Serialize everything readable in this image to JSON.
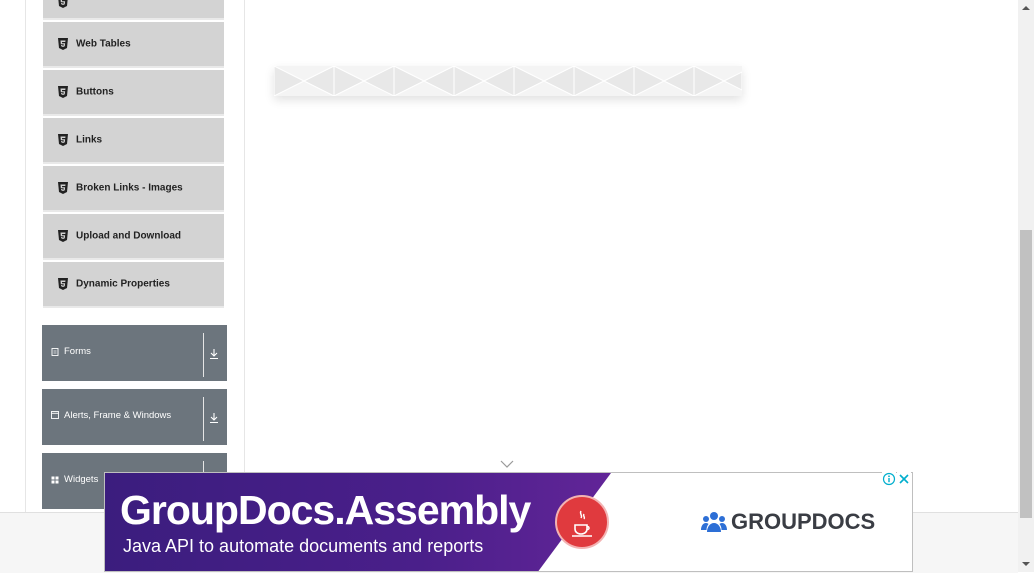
{
  "sidebar": {
    "elements_items": [
      {
        "label": "Web Tables"
      },
      {
        "label": "Buttons"
      },
      {
        "label": "Links"
      },
      {
        "label": "Broken Links - Images"
      },
      {
        "label": "Upload and Download"
      },
      {
        "label": "Dynamic Properties"
      }
    ],
    "groups": [
      {
        "label": "Forms",
        "icon": "document-icon"
      },
      {
        "label": "Alerts, Frame & Windows",
        "icon": "window-icon"
      },
      {
        "label": "Widgets",
        "icon": "grid-icon"
      }
    ]
  },
  "advertisement": {
    "title": "GroupDocs.Assembly",
    "subtitle": "Java API to automate documents and reports",
    "brand": "GROUPDOCS",
    "colors": {
      "purple": "#4a1f8a",
      "java_red": "#e03a3e",
      "brand_blue": "#2d6fd6"
    }
  },
  "colors": {
    "menu_item_bg": "#d3d3d3",
    "group_bg": "#6c757d"
  }
}
